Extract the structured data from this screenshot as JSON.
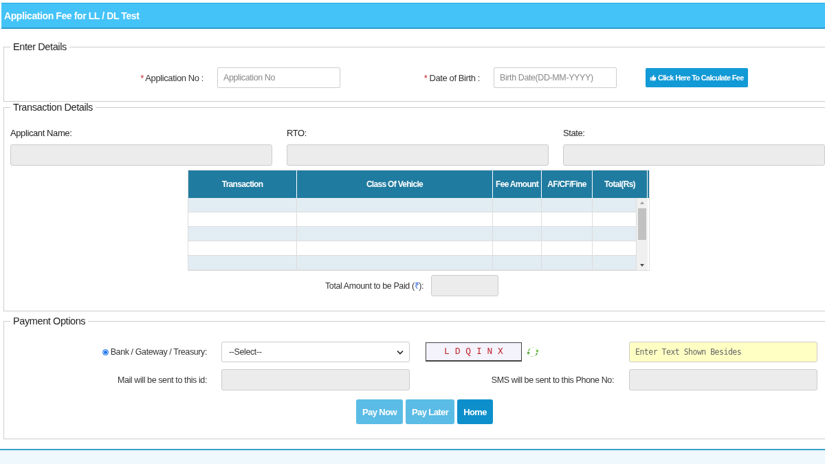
{
  "header": {
    "title": "Application Fee for LL / DL Test"
  },
  "enter_details": {
    "legend": "Enter Details",
    "fields": [
      {
        "required_mark": "*",
        "label": "Application No :",
        "placeholder": "Application No"
      },
      {
        "required_mark": "*",
        "label": "Date of Birth :",
        "placeholder": "Birth Date(DD-MM-YYYY)"
      }
    ],
    "calculate_button": {
      "label": "Click Here To Calculate Fee"
    }
  },
  "transaction_details": {
    "legend": "Transaction Details",
    "fields": [
      {
        "label": "Applicant Name:"
      },
      {
        "label": "RTO:"
      },
      {
        "label": "State:"
      }
    ],
    "table": {
      "columns": [
        "Transaction",
        "Class Of Vehicle",
        "Fee Amount",
        "AF/CF/Fine",
        "Total(Rs)"
      ]
    },
    "total": {
      "label": "Total Amount to be Paid (",
      "currency": "₹",
      "suffix": "):"
    }
  },
  "payment_options": {
    "legend": "Payment Options",
    "method": {
      "label": "Bank / Gateway / Treasury:",
      "selected": true
    },
    "select": {
      "value": "--Select--"
    },
    "captcha": {
      "text": "L D Q I N X",
      "placeholder": "Enter Text Shown Besides"
    },
    "mail": {
      "label": "Mail will be sent to this id:"
    },
    "sms": {
      "label": "SMS will be sent to this Phone No:"
    },
    "buttons": [
      {
        "label": "Pay Now",
        "disabled": true
      },
      {
        "label": "Pay Later",
        "disabled": true
      },
      {
        "label": "Home",
        "disabled": false
      }
    ]
  }
}
